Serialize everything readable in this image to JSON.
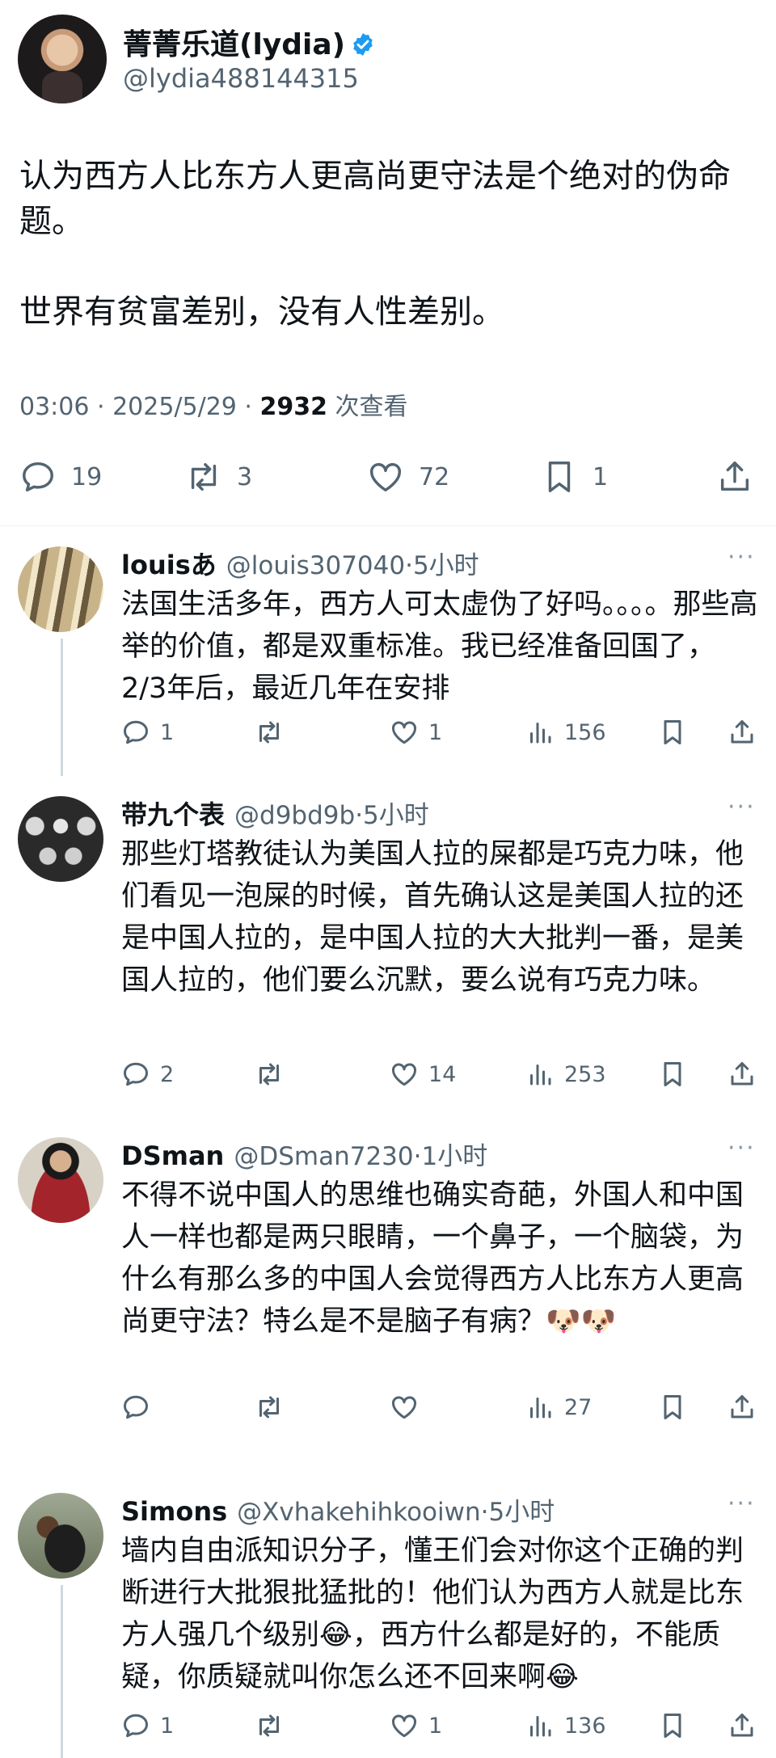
{
  "post": {
    "author_name": "菁菁乐道(lydia)",
    "author_handle": "@lydia488144315",
    "paragraphs": [
      "认为西方人比东方人更高尚更守法是个绝对的伪命题。",
      "世界有贫富差别，没有人性差别。"
    ],
    "time": "03:06 · 2025/5/29 · ",
    "views_count": "2932",
    "views_label": " 次查看",
    "replies": "19",
    "reposts": "3",
    "likes": "72",
    "bookmarks": "1"
  },
  "replies": [
    {
      "name": "louisあ",
      "handle": "@louis307040",
      "time": "·5小时",
      "text": "法国生活多年，西方人可太虚伪了好吗。。。。那些高举的价值，都是双重标准。我已经准备回国了，2/3年后，最近几年在安排",
      "replies": "1",
      "reposts": "",
      "likes": "1",
      "views": "156"
    },
    {
      "name": "带九个表",
      "handle": "@d9bd9b",
      "time": "·5小时",
      "text": "那些灯塔教徒认为美国人拉的屎都是巧克力味，他们看见一泡屎的时候，首先确认这是美国人拉的还是中国人拉的，是中国人拉的大大批判一番，是美国人拉的，他们要么沉默，要么说有巧克力味。",
      "replies": "2",
      "reposts": "",
      "likes": "14",
      "views": "253"
    },
    {
      "name": "DSman",
      "handle": "@DSman7230",
      "time": "·1小时",
      "text": "不得不说中国人的思维也确实奇葩，外国人和中国人一样也都是两只眼睛，一个鼻子，一个脑袋，为什么有那么多的中国人会觉得西方人比东方人更高尚更守法？特么是不是脑子有病？🐶🐶",
      "replies": "",
      "reposts": "",
      "likes": "",
      "views": "27"
    },
    {
      "name": "Simons",
      "handle": "@Xvhakehihkooiwn",
      "time": "·5小时",
      "text": "墙内自由派知识分子，懂王们会对你这个正确的判断进行大批狠批猛批的！他们认为西方人就是比东方人强几个级别😂，西方什么都是好的，不能质疑，你质疑就叫你怎么还不回来啊😂",
      "replies": "1",
      "reposts": "",
      "likes": "1",
      "views": "136"
    }
  ],
  "more_label": "···",
  "colors": {
    "text": "#0f1419",
    "secondary": "#536471",
    "verified": "#1d9bf0",
    "thread_line": "#cfd9de"
  }
}
